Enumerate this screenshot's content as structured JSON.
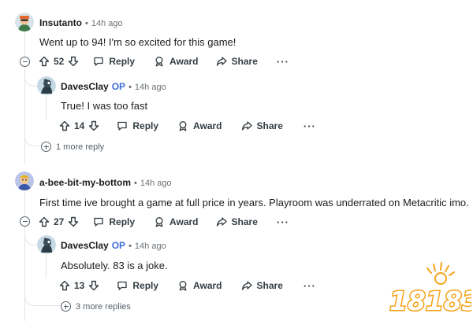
{
  "comments": [
    {
      "username": "Insutanto",
      "op": "",
      "separator": "•",
      "time": "14h ago",
      "body": "Went up to 94! I'm so excited for this game!",
      "votes": "52",
      "reply_label": "Reply",
      "award_label": "Award",
      "share_label": "Share",
      "more_label": "···",
      "replies": [
        {
          "username": "DavesClay",
          "op": "OP",
          "separator": "•",
          "time": "14h ago",
          "body": "True! I was too fast",
          "votes": "14",
          "reply_label": "Reply",
          "award_label": "Award",
          "share_label": "Share",
          "more_label": "···"
        }
      ],
      "more_replies": "1 more reply"
    },
    {
      "username": "a-bee-bit-my-bottom",
      "op": "",
      "separator": "•",
      "time": "14h ago",
      "body": "First time ive brought a game at full price in years. Playroom was underrated on Metacritic imo.",
      "votes": "27",
      "reply_label": "Reply",
      "award_label": "Award",
      "share_label": "Share",
      "more_label": "···",
      "replies": [
        {
          "username": "DavesClay",
          "op": "OP",
          "separator": "•",
          "time": "14h ago",
          "body": "Absolutely. 83 is a joke.",
          "votes": "13",
          "reply_label": "Reply",
          "award_label": "Award",
          "share_label": "Share",
          "more_label": "···"
        }
      ],
      "more_replies": "3 more replies"
    }
  ],
  "watermark": {
    "text": "18183",
    "brand_color": "#f5a31a"
  },
  "colors": {
    "accent_op": "#3d6cd9",
    "text": "#1c1c1c",
    "muted": "#6a7278",
    "thread_line": "#e0e4e7"
  },
  "icons": [
    "upvote-icon",
    "downvote-icon",
    "reply-icon",
    "award-icon",
    "share-icon",
    "collapse-icon",
    "expand-icon"
  ]
}
